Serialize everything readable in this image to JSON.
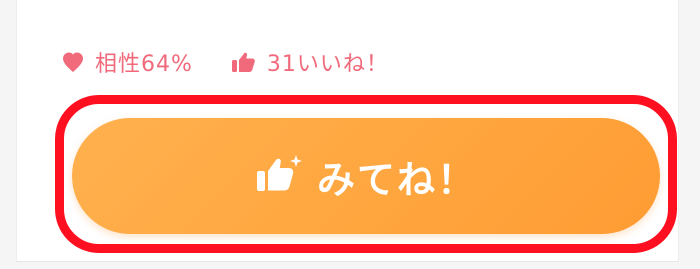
{
  "meta": {
    "compatibility_text": "相性64%",
    "likes_text": "31いいね！"
  },
  "cta": {
    "label": "みてね！"
  },
  "colors": {
    "accent_pink": "#f06a7b",
    "button_orange": "#ffa63f",
    "highlight_red": "#ff1020"
  },
  "icons": {
    "compatibility": "heart-icon",
    "likes": "thumbs-up-icon",
    "cta": "sparkle-thumbs-up-icon"
  }
}
